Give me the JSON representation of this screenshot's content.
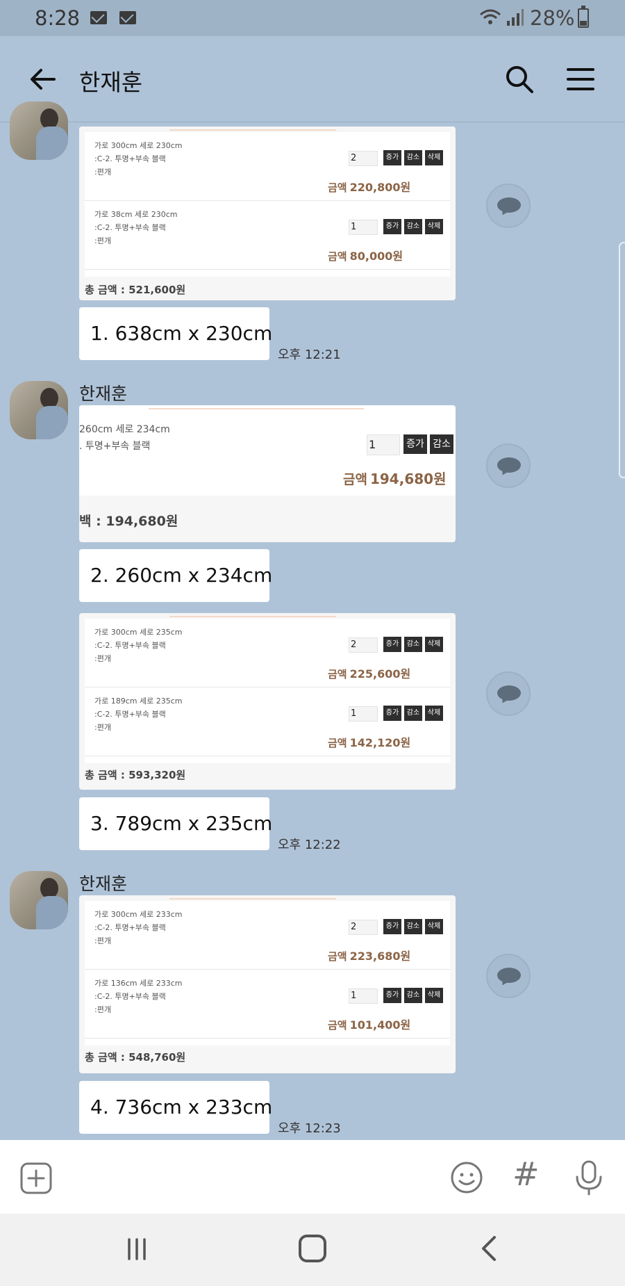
{
  "status_bar": {
    "time": "8:28",
    "battery_percent": "28%",
    "notification_icons": [
      "mail-icon",
      "mail-icon"
    ]
  },
  "header": {
    "title": "한재훈",
    "icons": [
      "back-arrow-icon",
      "search-icon",
      "menu-icon"
    ]
  },
  "messages": {
    "card1": {
      "rows": [
        {
          "desc": [
            "가로 300cm 세로 230cm",
            ":C-2. 투명+부속 블랙",
            ":편개"
          ],
          "qty": "2",
          "price_label": "금액",
          "price": "220,800원"
        },
        {
          "desc": [
            "가로 38cm 세로 230cm",
            ":C-2. 투명+부속 블랙",
            ":편개"
          ],
          "qty": "1",
          "price_label": "금액",
          "price": "80,000원"
        }
      ],
      "total": "총 금액 : 521,600원"
    },
    "text1": {
      "text": "1. 638cm x 230cm",
      "time": "오후 12:21"
    },
    "sender2": "한재훈",
    "card2": {
      "desc1": "260cm 세로 234cm",
      "desc2": ". 투명+부속 블랙",
      "qty": "1",
      "price_label": "금액",
      "price": "194,680원",
      "total": "백 : 194,680원"
    },
    "text2": {
      "text": "2. 260cm x 234cm"
    },
    "card3": {
      "rows": [
        {
          "desc": [
            "가로 300cm 세로 235cm",
            ":C-2. 투명+부속 블랙",
            ":편개"
          ],
          "qty": "2",
          "price_label": "금액",
          "price": "225,600원"
        },
        {
          "desc": [
            "가로 189cm 세로 235cm",
            ":C-2. 투명+부속 블랙",
            ":편개"
          ],
          "qty": "1",
          "price_label": "금액",
          "price": "142,120원"
        }
      ],
      "total": "총 금액 : 593,320원"
    },
    "text3": {
      "text": "3. 789cm x 235cm",
      "time": "오후 12:22"
    },
    "sender4": "한재훈",
    "card4": {
      "rows": [
        {
          "desc": [
            "가로 300cm 세로 233cm",
            ":C-2. 투명+부속 블랙",
            ":편개"
          ],
          "qty": "2",
          "price_label": "금액",
          "price": "223,680원"
        },
        {
          "desc": [
            "가로 136cm 세로 233cm",
            ":C-2. 투명+부속 블랙",
            ":편개"
          ],
          "qty": "1",
          "price_label": "금액",
          "price": "101,400원"
        }
      ],
      "total": "총 금액 : 548,760원"
    },
    "text4": {
      "text": "4. 736cm x 233cm",
      "time": "오후 12:23"
    }
  },
  "cart_buttons": {
    "increase": "증가",
    "decrease": "감소",
    "delete": "삭제"
  },
  "input_bar": {
    "hash_symbol": "#",
    "icons": [
      "plus-icon",
      "emoji-icon",
      "hash-icon",
      "mic-icon"
    ]
  },
  "colors": {
    "chat_background": "#afc3d8",
    "price_color": "#8b6446",
    "button_dark": "#2e2e2e"
  }
}
